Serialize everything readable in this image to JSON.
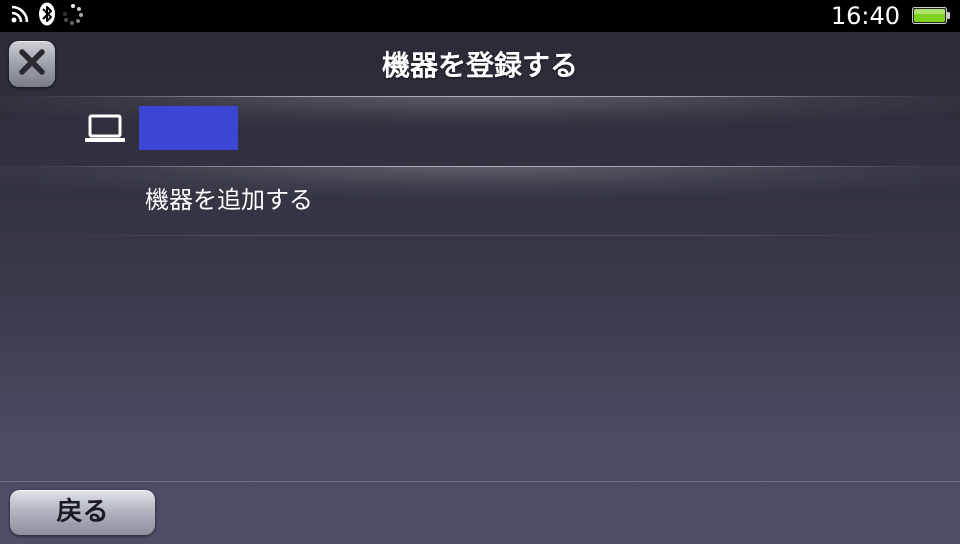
{
  "status_bar": {
    "icons": [
      "wifi-icon",
      "bluetooth-icon",
      "loading-icon"
    ],
    "time": "16:40",
    "battery_color": "#7ed321"
  },
  "header": {
    "close_icon": "close-icon",
    "title": "機器を登録する"
  },
  "list": {
    "device_item": {
      "icon": "laptop-icon",
      "name_block_color": "#3b46d4"
    },
    "add_item": {
      "label": "機器を追加する"
    }
  },
  "footer": {
    "back_label": "戻る"
  }
}
